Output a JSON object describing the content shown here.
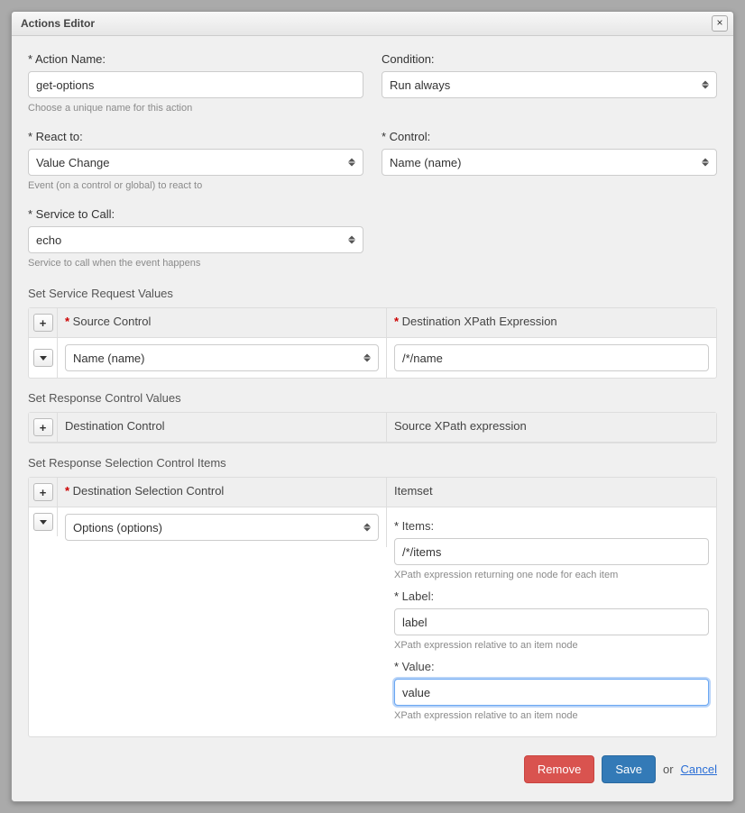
{
  "dialog": {
    "title": "Actions Editor"
  },
  "form": {
    "actionName": {
      "label": "Action Name:",
      "value": "get-options",
      "helper": "Choose a unique name for this action"
    },
    "condition": {
      "label": "Condition:",
      "value": "Run always"
    },
    "reactTo": {
      "label": "React to:",
      "value": "Value Change",
      "helper": "Event (on a control or global) to react to"
    },
    "control": {
      "label": "Control:",
      "value": "Name (name)"
    },
    "service": {
      "label": "Service to Call:",
      "value": "echo",
      "helper": "Service to call when the event happens"
    }
  },
  "requestValues": {
    "title": "Set Service Request Values",
    "headers": {
      "source": "Source Control",
      "dest": "Destination XPath Expression"
    },
    "row": {
      "source": "Name (name)",
      "dest": "/*/name"
    }
  },
  "responseControlValues": {
    "title": "Set Response Control Values",
    "headers": {
      "dest": "Destination Control",
      "source": "Source XPath expression"
    }
  },
  "responseSelection": {
    "title": "Set Response Selection Control Items",
    "headers": {
      "dest": "Destination Selection Control",
      "itemset": "Itemset"
    },
    "row": {
      "dest": "Options (options)",
      "itemset": {
        "items": {
          "label": "Items:",
          "value": "/*/items",
          "helper": "XPath expression returning one node for each item"
        },
        "label": {
          "label": "Label:",
          "value": "label",
          "helper": "XPath expression relative to an item node"
        },
        "value": {
          "label": "Value:",
          "value": "value",
          "helper": "XPath expression relative to an item node"
        }
      }
    }
  },
  "footer": {
    "remove": "Remove",
    "save": "Save",
    "or": "or",
    "cancel": "Cancel"
  }
}
